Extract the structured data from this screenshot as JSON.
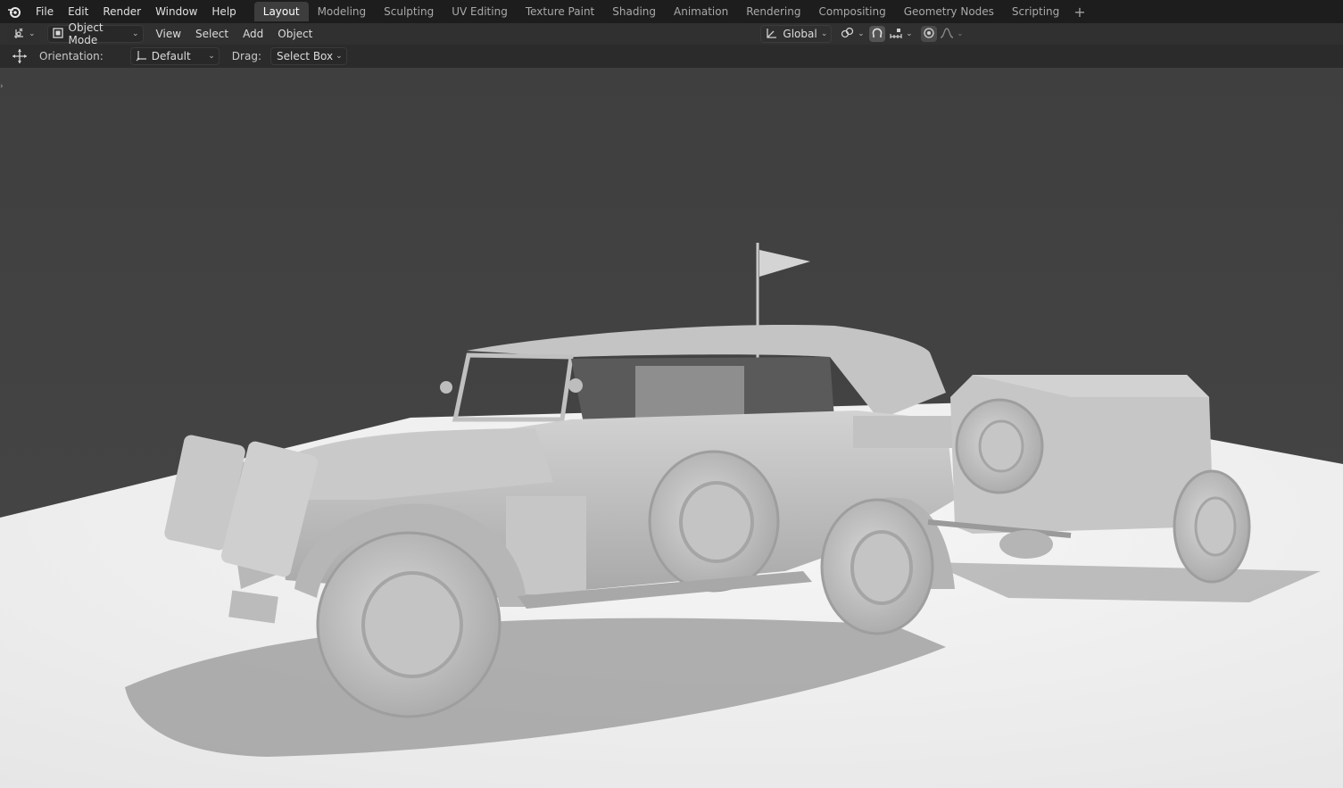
{
  "menubar": {
    "items": [
      "File",
      "Edit",
      "Render",
      "Window",
      "Help"
    ]
  },
  "workspaces": {
    "tabs": [
      "Layout",
      "Modeling",
      "Sculpting",
      "UV Editing",
      "Texture Paint",
      "Shading",
      "Animation",
      "Rendering",
      "Compositing",
      "Geometry Nodes",
      "Scripting"
    ],
    "active": "Layout",
    "add_label": "+"
  },
  "header": {
    "mode_label": "Object Mode",
    "view_label": "View",
    "select_label": "Select",
    "add_label": "Add",
    "object_label": "Object",
    "transform_orientation": "Global"
  },
  "tool_settings": {
    "orientation_label": "Orientation:",
    "orientation_value": "Default",
    "drag_label": "Drag:",
    "drag_value": "Select Box"
  },
  "colors": {
    "topbar_bg": "#1d1d1d",
    "header_bg": "#303030",
    "active_tab_bg": "#3d3d3d",
    "viewport_bg": "#424242",
    "ground": "#f2f2f2"
  }
}
